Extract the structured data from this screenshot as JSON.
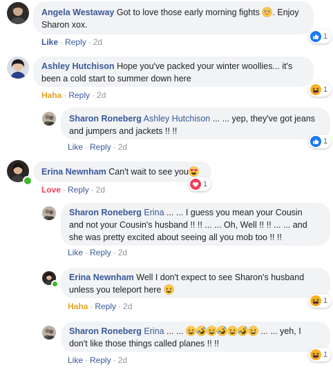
{
  "comments": [
    {
      "author": "Angela Westaway",
      "text": "Got to love those early morning fights",
      "text_after": ". Enjoy Sharon xox.",
      "emoji": "flushed-face-icon",
      "actions": {
        "reaction": "Like",
        "reply": "Reply",
        "time": "2d"
      },
      "reaction_icon": "like-icon",
      "reaction_count": "1"
    },
    {
      "author": "Ashley Hutchison",
      "text_line1": "Hope you've packed your winter woollies... it's",
      "text_line2": "been a cold start to summer down here",
      "actions": {
        "reaction": "Haha",
        "reply": "Reply",
        "time": "2d"
      },
      "reaction_icon": "haha-icon",
      "reaction_count": "1"
    },
    {
      "author": "Sharon Roneberg",
      "mention": "Ashley Hutchison",
      "text_line1": "... ... yep, they've got jeans",
      "text_line2": "and jumpers and jackets !! !!",
      "actions": {
        "reaction": "Like",
        "reply": "Reply",
        "time": "2d"
      },
      "reaction_icon": "like-icon",
      "reaction_count": "1"
    },
    {
      "author": "Erina Newnham",
      "text": "Can't wait to see you",
      "emoji": "heart-eyes-icon",
      "actions": {
        "reaction": "Love",
        "reply": "Reply",
        "time": "2d"
      },
      "reaction_icon": "love-icon",
      "reaction_count": "1"
    },
    {
      "author": "Sharon Roneberg",
      "mention": "Erina",
      "text_line1": "... ... I guess you mean your Cousin",
      "text_line2": "and not your Cousin's husband !! !! ... ... Oh, Well !! !! ... ... and",
      "text_line3": "she was pretty excited about seeing all you mob too !! !!",
      "actions": {
        "reaction": "Like",
        "reply": "Reply",
        "time": "2d"
      }
    },
    {
      "author": "Erina Newnham",
      "text_line1": "Well I don't expect to see Sharon's husband",
      "text_line2": "unless you teleport here",
      "emoji": "grinning-squint-icon",
      "actions": {
        "reaction": "Haha",
        "reply": "Reply",
        "time": "2d"
      },
      "reaction_icon": "haha-icon",
      "reaction_count": "1"
    },
    {
      "author": "Sharon Roneberg",
      "mention": "Erina",
      "text_line1_before": "... ...",
      "emoji_sequence": [
        "grinning-squint-icon",
        "rofl-icon",
        "grinning-squint-icon",
        "rofl-icon",
        "grinning-squint-icon",
        "rofl-icon",
        "grinning-squint-icon"
      ],
      "text_line1_after": "... ... yeh, I",
      "text_line2": "don't like those things called planes !! !!",
      "actions": {
        "reaction": "Like",
        "reply": "Reply",
        "time": "2d"
      },
      "reaction_icon": "haha-icon",
      "reaction_count": "1"
    }
  ],
  "separator": "·",
  "colors": {
    "link": "#385898",
    "haha": "#e5a323",
    "love": "#f33e58",
    "muted": "#90949c",
    "bubble": "#f2f3f5",
    "online": "#42b72a"
  }
}
